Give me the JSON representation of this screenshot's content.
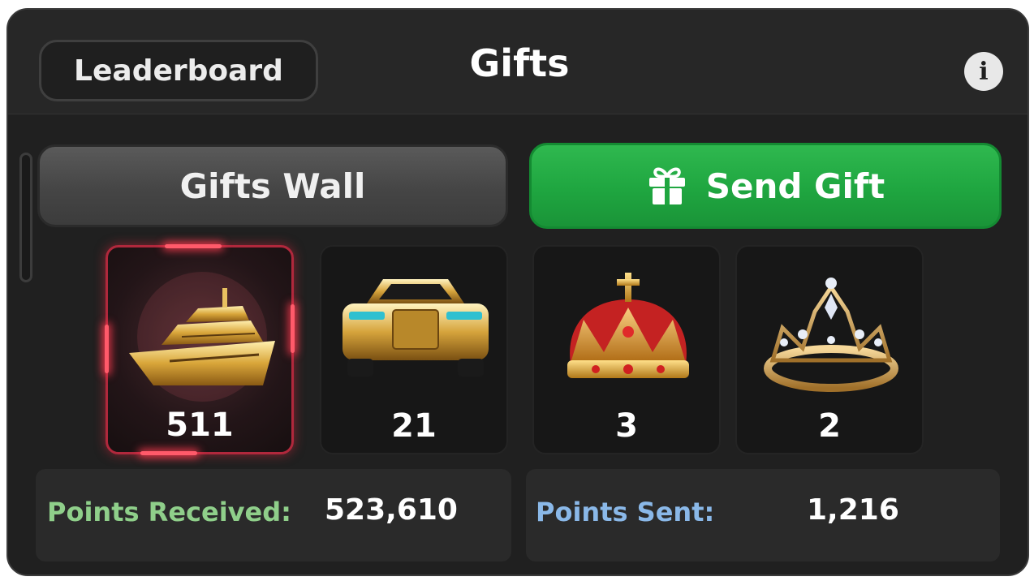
{
  "header": {
    "leaderboard_label": "Leaderboard",
    "title": "Gifts",
    "info_icon": "info-icon",
    "info_glyph": "i"
  },
  "actions": {
    "gifts_wall_label": "Gifts Wall",
    "send_gift_label": "Send Gift",
    "send_gift_icon": "gift-icon",
    "accent_green": "#22a845"
  },
  "gifts": [
    {
      "name": "yacht",
      "count": "511",
      "selected": true
    },
    {
      "name": "luxury-car",
      "count": "21",
      "selected": false
    },
    {
      "name": "red-crown",
      "count": "3",
      "selected": false
    },
    {
      "name": "diamond-tiara",
      "count": "2",
      "selected": false
    }
  ],
  "stats": {
    "received_label": "Points Received",
    "received_colon": ":",
    "received_value": "523,610",
    "received_color": "#8fcf8a",
    "sent_label": "Points Sent",
    "sent_colon": ":",
    "sent_value": "1,216",
    "sent_color": "#8ab8e8"
  }
}
